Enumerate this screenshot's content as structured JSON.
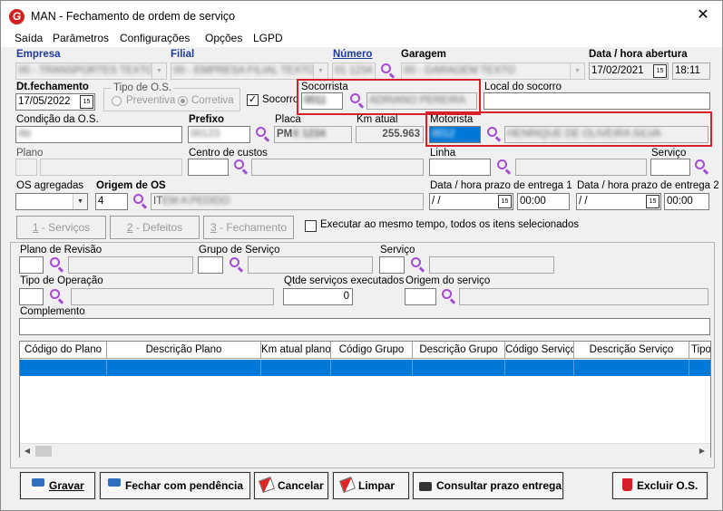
{
  "window": {
    "title": "MAN - Fechamento de ordem de serviço",
    "close": "✕"
  },
  "menu": [
    "Saída",
    "Parâmetros",
    "Configurações",
    "Opções",
    "LGPD"
  ],
  "labels": {
    "empresa": "Empresa",
    "filial": "Filial",
    "numero": "Número",
    "garagem": "Garagem",
    "data_abertura": "Data / hora abertura",
    "dt_fechamento": "Dt.fechamento",
    "tipo_os": "Tipo de O.S.",
    "preventiva": "Preventiva",
    "corretiva": "Corretiva",
    "socorro": "Socorro",
    "socorrista": "Socorrista",
    "local_socorro": "Local do socorro",
    "condicao": "Condição da O.S.",
    "prefixo": "Prefixo",
    "placa": "Placa",
    "km_atual": "Km atual",
    "motorista": "Motorista",
    "plano": "Plano",
    "centro_custos": "Centro de custos",
    "linha": "Linha",
    "servico": "Serviço",
    "os_agregadas": "OS agregadas",
    "origem_os": "Origem de OS",
    "prazo1": "Data / hora prazo de entrega 1",
    "prazo2": "Data / hora prazo de entrega 2",
    "executar": "Executar ao mesmo tempo, todos os itens selecionados",
    "plano_revisao": "Plano de Revisão",
    "grupo_servico": "Grupo de Serviço",
    "servico2": "Serviço",
    "tipo_operacao": "Tipo de Operação",
    "qtde_exec": "Qtde serviços executados",
    "origem_servico": "Origem do serviço",
    "complemento": "Complemento"
  },
  "values": {
    "empresa": "00 - TRANSPORTES TEXTO",
    "filial": "00 - EMPRESA FILIAL TEXTO",
    "numero": "01 1234",
    "garagem": "00 - GARAGEM TEXTO",
    "data_abertura": "17/02/2021",
    "hora_abertura": "18:11",
    "dt_fechamento": "17/05/2022",
    "socorrista_cod": "0011",
    "socorrista_nome": "ADRIANO PEREIRA",
    "local_socorro": "",
    "condicao": "Ab",
    "prefixo": "00123",
    "placa": "PM",
    "placa_rest": "X 1234",
    "km_atual": "255.963",
    "motorista_cod": "0012",
    "motorista_nome": "HENRIQUE DE OLIVEIRA SILVA",
    "origem_cod": "4",
    "origem_desc": "IT",
    "origem_desc_rest": "EM A PEDIDO",
    "prazo1_data": " / /",
    "prazo1_hora": "00:00",
    "prazo2_data": " / /",
    "prazo2_hora": "00:00",
    "qtde_exec": "0"
  },
  "tabs": [
    {
      "key": "1",
      "label": " - Serviços"
    },
    {
      "key": "2",
      "label": " - Defeitos"
    },
    {
      "key": "3",
      "label": " - Fechamento"
    }
  ],
  "grid_columns": [
    "Código do Plano",
    "Descrição Plano",
    "Km atual plano",
    "Código Grupo",
    "Descrição Grupo",
    "Código Serviço",
    "Descrição Serviço",
    "Tipo"
  ],
  "buttons": {
    "gravar": "Gravar",
    "fechar": "Fechar com pendência",
    "cancelar": "Cancelar",
    "limpar": "Limpar",
    "consultar": "Consultar prazo entrega",
    "excluir": "Excluir O.S."
  },
  "colors": {
    "accent": "#0078d7",
    "highlight": "#d8202a",
    "search": "#a64bd6"
  }
}
